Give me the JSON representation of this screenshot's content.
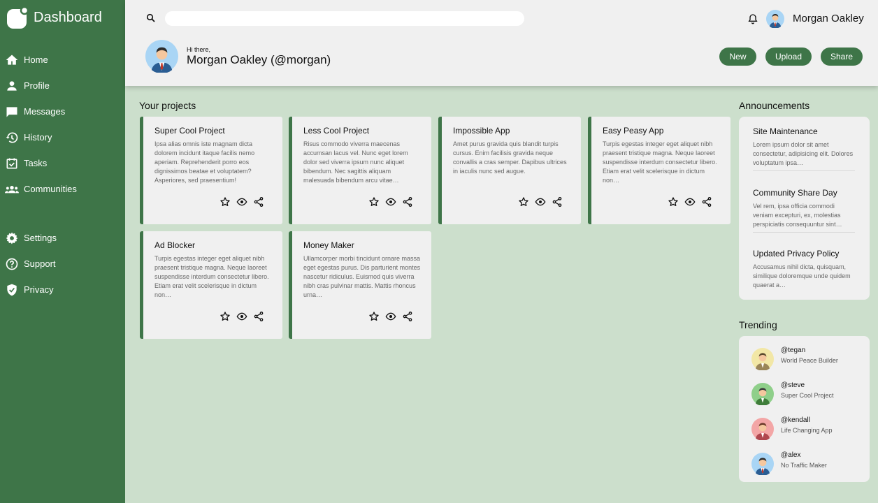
{
  "app": {
    "title": "Dashboard"
  },
  "sidebar": {
    "items": [
      {
        "label": "Home",
        "icon": "home-icon"
      },
      {
        "label": "Profile",
        "icon": "person-icon"
      },
      {
        "label": "Messages",
        "icon": "chat-icon"
      },
      {
        "label": "History",
        "icon": "history-icon"
      },
      {
        "label": "Tasks",
        "icon": "tasks-icon"
      },
      {
        "label": "Communities",
        "icon": "group-icon"
      },
      {
        "label": "Settings",
        "icon": "gear-icon"
      },
      {
        "label": "Support",
        "icon": "help-icon"
      },
      {
        "label": "Privacy",
        "icon": "shield-icon"
      }
    ]
  },
  "header": {
    "search": {
      "value": "",
      "placeholder": ""
    },
    "user_name": "Morgan Oakley",
    "greeting": "Hi there,",
    "user_full": "Morgan Oakley (@morgan)",
    "buttons": {
      "new": "New",
      "upload": "Upload",
      "share": "Share"
    }
  },
  "projects": {
    "title": "Your projects",
    "items": [
      {
        "title": "Super Cool Project",
        "desc": "Ipsa alias omnis iste magnam dicta dolorem incidunt itaque facilis nemo aperiam. Reprehenderit porro eos dignissimos beatae et voluptatem? Asperiores, sed praesentium!"
      },
      {
        "title": "Less Cool Project",
        "desc": "Risus commodo viverra maecenas accumsan lacus vel. Nunc eget lorem dolor sed viverra ipsum nunc aliquet bibendum. Nec sagittis aliquam malesuada bibendum arcu vitae…"
      },
      {
        "title": "Impossible App",
        "desc": "Amet purus gravida quis blandit turpis cursus. Enim facilisis gravida neque convallis a cras semper. Dapibus ultrices in iaculis nunc sed augue."
      },
      {
        "title": "Easy Peasy App",
        "desc": "Turpis egestas integer eget aliquet nibh praesent tristique magna. Neque laoreet suspendisse interdum consectetur libero. Etiam erat velit scelerisque in dictum non…"
      },
      {
        "title": "Ad Blocker",
        "desc": "Turpis egestas integer eget aliquet nibh praesent tristique magna. Neque laoreet suspendisse interdum consectetur libero. Etiam erat velit scelerisque in dictum non…"
      },
      {
        "title": "Money Maker",
        "desc": "Ullamcorper morbi tincidunt ornare massa eget egestas purus. Dis parturient montes nascetur ridiculus. Euismod quis viverra nibh cras pulvinar mattis. Mattis rhoncus urna…"
      }
    ]
  },
  "announcements": {
    "title": "Announcements",
    "items": [
      {
        "title": "Site Maintenance",
        "desc": "Lorem ipsum dolor sit amet consectetur, adipisicing elit. Dolores voluptatum ipsa…"
      },
      {
        "title": "Community Share Day",
        "desc": "Vel rem, ipsa officia commodi veniam excepturi, ex, molestias perspiciatis consequuntur sint…"
      },
      {
        "title": "Updated Privacy Policy",
        "desc": "Accusamus nihil dicta, quisquam, similique doloremque unde quidem quaerat a…"
      }
    ]
  },
  "trending": {
    "title": "Trending",
    "items": [
      {
        "handle": "@tegan",
        "sub": "World Peace Builder",
        "color": "#f2e7a6"
      },
      {
        "handle": "@steve",
        "sub": "Super Cool Project",
        "color": "#8fcf8a"
      },
      {
        "handle": "@kendall",
        "sub": "Life Changing App",
        "color": "#f3a6a6"
      },
      {
        "handle": "@alex",
        "sub": "No Traffic Maker",
        "color": "#a9d5f5"
      }
    ]
  },
  "colors": {
    "brand": "#3e7548",
    "background": "#ccdfcc",
    "surface": "#f0f0f0"
  }
}
